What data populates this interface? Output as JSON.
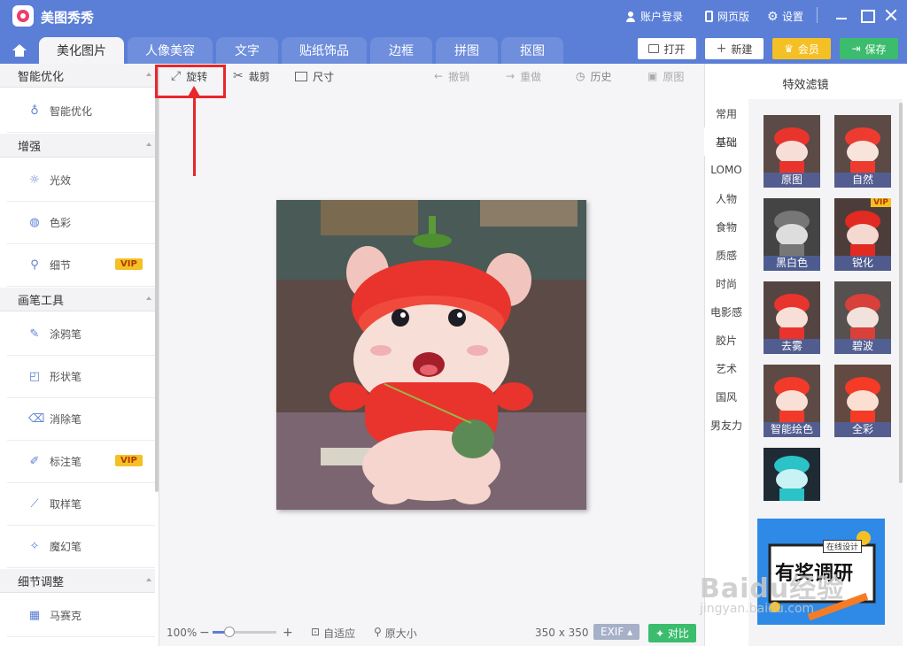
{
  "app": {
    "title": "美图秀秀"
  },
  "titlebar": {
    "login": "账户登录",
    "web": "网页版",
    "settings": "设置"
  },
  "tabs": [
    "美化图片",
    "人像美容",
    "文字",
    "贴纸饰品",
    "边框",
    "拼图",
    "抠图"
  ],
  "header_buttons": {
    "open": "打开",
    "new": "新建",
    "vip": "会员",
    "save": "保存"
  },
  "sidebar": {
    "sections": [
      {
        "title": "智能优化",
        "items": [
          {
            "label": "智能优化",
            "icon": "bulb-icon"
          }
        ]
      },
      {
        "title": "增强",
        "items": [
          {
            "label": "光效",
            "icon": "sun-icon"
          },
          {
            "label": "色彩",
            "icon": "palette-icon"
          },
          {
            "label": "细节",
            "icon": "magnifier-icon",
            "badge": "VIP"
          }
        ]
      },
      {
        "title": "画笔工具",
        "items": [
          {
            "label": "涂鸦笔",
            "icon": "graffiti-icon"
          },
          {
            "label": "形状笔",
            "icon": "shape-icon"
          },
          {
            "label": "消除笔",
            "icon": "eraser-icon"
          },
          {
            "label": "标注笔",
            "icon": "pen-icon",
            "badge": "VIP"
          },
          {
            "label": "取样笔",
            "icon": "dropper-icon"
          },
          {
            "label": "魔幻笔",
            "icon": "magic-wand-icon"
          }
        ]
      },
      {
        "title": "细节调整",
        "items": [
          {
            "label": "马赛克",
            "icon": "mosaic-icon"
          }
        ]
      }
    ]
  },
  "toolbar": {
    "rotate": "旋转",
    "crop": "裁剪",
    "size": "尺寸",
    "undo": "撤销",
    "redo": "重做",
    "history": "历史",
    "original": "原图"
  },
  "status": {
    "zoom": "100%",
    "fit": "自适应",
    "actual": "原大小",
    "dimensions": "350 x 350",
    "exif": "EXIF",
    "compare": "对比"
  },
  "filters": {
    "title": "特效滤镜",
    "categories": [
      "常用",
      "基础",
      "LOMO",
      "人物",
      "食物",
      "质感",
      "时尚",
      "电影感",
      "胶片",
      "艺术",
      "国风",
      "男友力"
    ],
    "active_category": "基础",
    "items": [
      "原图",
      "自然",
      "黑白色",
      "锐化",
      "去雾",
      "碧波",
      "智能绘色",
      "全彩"
    ],
    "vip_tag": "VIP"
  },
  "ad": {
    "tag": "在线设计",
    "text": "有奖调研"
  },
  "watermark": {
    "logo": "Baidu经验",
    "url": "jingyan.baidu.com"
  },
  "colors": {
    "brand": "#5b7fd7",
    "highlight": "#e8262b",
    "vip": "#f5c025",
    "save": "#3bbd6d"
  }
}
